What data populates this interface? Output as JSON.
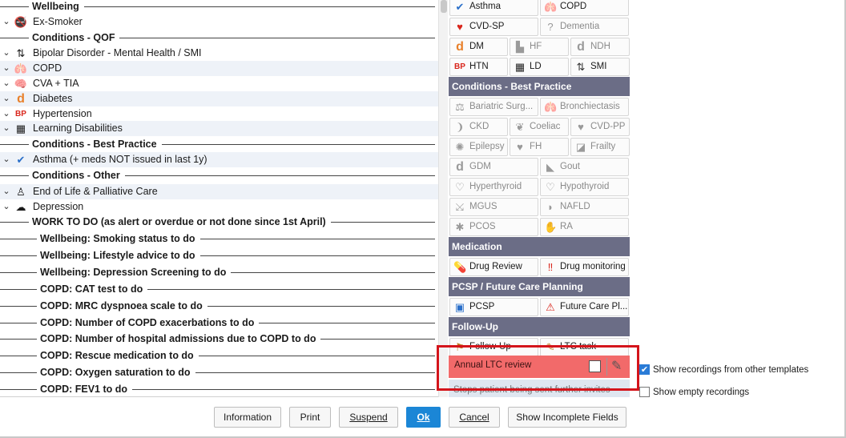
{
  "tree": {
    "rows": [
      {
        "type": "header",
        "label": "Wellbeing"
      },
      {
        "type": "item",
        "chev": "⌄",
        "icon": "no-smoking-icon",
        "glyph": "🚭",
        "label": "Ex-Smoker"
      },
      {
        "type": "header",
        "label": "Conditions - QOF"
      },
      {
        "type": "item",
        "chev": "⌄",
        "icon": "arrows-icon",
        "glyph": "⇅",
        "label": "Bipolar Disorder - Mental Health / SMI"
      },
      {
        "type": "item",
        "chev": "⌄",
        "icon": "lungs-icon",
        "glyph": "🫁",
        "label": "COPD"
      },
      {
        "type": "item",
        "chev": "⌄",
        "icon": "brain-icon",
        "glyph": "🧠",
        "label": "CVA + TIA"
      },
      {
        "type": "item",
        "chev": "⌄",
        "icon": "diabetes-d-icon",
        "glyph": "d",
        "label": "Diabetes"
      },
      {
        "type": "item",
        "chev": "⌄",
        "icon": "bp-icon",
        "glyph": "BP",
        "label": "Hypertension"
      },
      {
        "type": "item",
        "chev": "⌄",
        "icon": "ld-icon",
        "glyph": "▦",
        "label": "Learning Disabilities"
      },
      {
        "type": "header",
        "label": "Conditions - Best Practice"
      },
      {
        "type": "item",
        "chev": "⌄",
        "icon": "checkmark-icon",
        "glyph": "✔",
        "label": "Asthma (+ meds NOT issued in last 1y)"
      },
      {
        "type": "header",
        "label": "Conditions - Other"
      },
      {
        "type": "item",
        "chev": "⌄",
        "icon": "palliative-care-icon",
        "glyph": "♙",
        "label": "End of Life & Palliative Care"
      },
      {
        "type": "item",
        "chev": "⌄",
        "icon": "depression-icon",
        "glyph": "☁",
        "label": "Depression"
      },
      {
        "type": "header",
        "label": "WORK TO DO (as alert or overdue or not done since 1st April)"
      },
      {
        "type": "subheader",
        "label": "Wellbeing: Smoking status to do"
      },
      {
        "type": "subheader",
        "label": "Wellbeing: Lifestyle advice to do"
      },
      {
        "type": "subheader",
        "label": "Wellbeing: Depression Screening to do"
      },
      {
        "type": "subheader",
        "label": "COPD: CAT test to do"
      },
      {
        "type": "subheader",
        "label": "COPD: MRC dyspnoea scale to do"
      },
      {
        "type": "subheader",
        "label": "COPD: Number of COPD exacerbations to do"
      },
      {
        "type": "subheader",
        "label": "COPD: Number of hospital admissions due to COPD to do"
      },
      {
        "type": "subheader",
        "label": "COPD: Rescue medication to do"
      },
      {
        "type": "subheader",
        "label": "COPD: Oxygen saturation to do"
      },
      {
        "type": "subheader",
        "label": "COPD: FEV1 to do"
      }
    ]
  },
  "panel": {
    "top_buttons": [
      {
        "label": "Asthma",
        "icon": "checkmark-icon",
        "glyph": "✔",
        "color": "#2a6fc9",
        "disabled": false
      },
      {
        "label": "COPD",
        "icon": "lungs-icon",
        "glyph": "🫁",
        "color": "#b07a30",
        "disabled": false
      },
      {
        "label": "CVD-SP",
        "icon": "heart-icon",
        "glyph": "♥",
        "color": "#d9261c",
        "disabled": false
      },
      {
        "label": "Dementia",
        "icon": "question-icon",
        "glyph": "?",
        "color": "#999999",
        "disabled": true
      },
      {
        "label": "DM",
        "icon": "diabetes-d-icon",
        "glyph": "d",
        "color": "#e8802a",
        "disabled": false
      },
      {
        "label": "HF",
        "icon": "heart-failure-icon",
        "glyph": "▙",
        "color": "#999999",
        "disabled": true
      },
      {
        "label": "NDH",
        "icon": "ndh-d-icon",
        "glyph": "d",
        "color": "#999999",
        "disabled": true
      },
      {
        "label": "HTN",
        "icon": "bp-icon",
        "glyph": "BP",
        "color": "#d9261c",
        "disabled": false
      },
      {
        "label": "LD",
        "icon": "ld-icon",
        "glyph": "▦",
        "color": "#222222",
        "disabled": false
      },
      {
        "label": "SMI",
        "icon": "arrows-icon",
        "glyph": "⇅",
        "color": "#333333",
        "disabled": false
      }
    ],
    "sections": [
      {
        "title": "Conditions - Best Practice",
        "buttons": [
          {
            "label": "Bariatric Surg...",
            "icon": "scales-icon",
            "glyph": "⚖"
          },
          {
            "label": "Bronchiectasis",
            "icon": "lungs-icon",
            "glyph": "🫁"
          },
          {
            "label": "CKD",
            "icon": "kidney-icon",
            "glyph": "❩"
          },
          {
            "label": "Coeliac",
            "icon": "coeliac-icon",
            "glyph": "❦"
          },
          {
            "label": "CVD-PP",
            "icon": "heart-icon",
            "glyph": "♥"
          },
          {
            "label": "Epilepsy",
            "icon": "epilepsy-icon",
            "glyph": "✺"
          },
          {
            "label": "FH",
            "icon": "fh-heart-icon",
            "glyph": "♥"
          },
          {
            "label": "Frailty",
            "icon": "frailty-icon",
            "glyph": "◪"
          },
          {
            "label": "GDM",
            "icon": "gdm-d-icon",
            "glyph": "d"
          },
          {
            "label": "Gout",
            "icon": "foot-icon",
            "glyph": "◣"
          },
          {
            "label": "Hyperthyroid",
            "icon": "thyroid-icon",
            "glyph": "♡"
          },
          {
            "label": "Hypothyroid",
            "icon": "thyroid-icon",
            "glyph": "♡"
          },
          {
            "label": "MGUS",
            "icon": "mgus-icon",
            "glyph": "⤩"
          },
          {
            "label": "NAFLD",
            "icon": "liver-icon",
            "glyph": "◗"
          },
          {
            "label": "PCOS",
            "icon": "pcos-icon",
            "glyph": "✱"
          },
          {
            "label": "RA",
            "icon": "hand-icon",
            "glyph": "✋"
          }
        ]
      },
      {
        "title": "Medication",
        "buttons": [
          {
            "label": "Drug Review",
            "icon": "pill-icon",
            "glyph": "💊",
            "color": "#c2185b"
          },
          {
            "label": "Drug monitoring",
            "icon": "exclamation-icon",
            "glyph": "‼",
            "color": "#d9261c"
          }
        ]
      },
      {
        "title": "PCSP / Future Care Planning",
        "buttons": [
          {
            "label": "PCSP",
            "icon": "person-card-icon",
            "glyph": "▣",
            "color": "#2a6fc9"
          },
          {
            "label": "Future Care Pl...",
            "icon": "warning-icon",
            "glyph": "⚠",
            "color": "#d9261c"
          }
        ]
      },
      {
        "title": "Follow-Up",
        "buttons": [
          {
            "label": "Follow-Up",
            "icon": "follow-up-icon",
            "glyph": "⚑",
            "color": "#c07a20"
          },
          {
            "label": "LTC task",
            "icon": "task-icon",
            "glyph": "✎",
            "color": "#c07a20"
          }
        ]
      }
    ],
    "ltc_review_label": "Annual LTC review",
    "last_row_label": "Stops patient being sent further invites"
  },
  "options": {
    "show_other_templates": {
      "label": "Show recordings from other templates",
      "checked": true
    },
    "show_empty": {
      "label": "Show empty recordings",
      "checked": false
    }
  },
  "footer": {
    "information": "Information",
    "print": "Print",
    "suspend": "Suspend",
    "ok": "Ok",
    "cancel": "Cancel",
    "show_incomplete": "Show Incomplete Fields"
  }
}
